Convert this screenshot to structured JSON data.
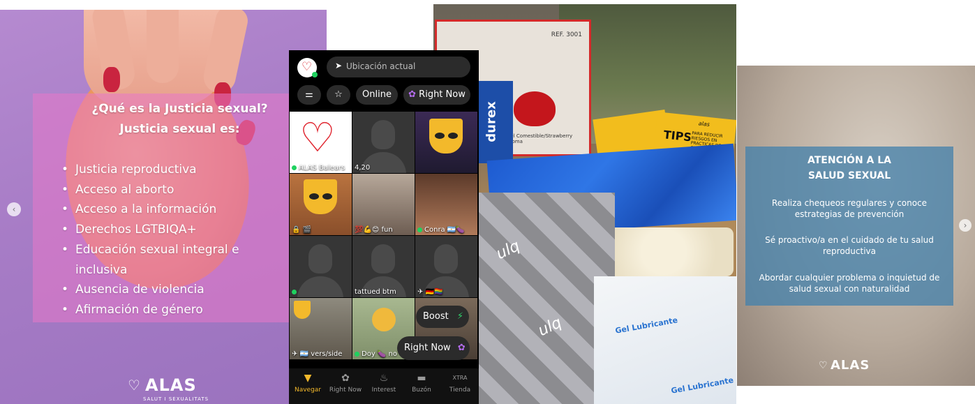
{
  "slide1": {
    "title_line1": "¿Qué es la Justicia sexual?",
    "title_line2": "Justicia sexual es:",
    "items": [
      "Justicia reproductiva",
      "Acceso al aborto",
      "Acceso a la información",
      "Derechos LGTBIQA+",
      "Educación sexual integral e inclusiva",
      "Ausencia de violencia",
      "Afirmación de género"
    ],
    "logo_text": "ALAS",
    "logo_sub": "SALUT I SEXUALITATS",
    "prev_arrow": "‹"
  },
  "slide2": {
    "location_placeholder": "Ubicación actual",
    "filters": {
      "online_label": "Online",
      "right_now_label": "Right Now"
    },
    "grid": [
      {
        "caption": "ALAS Balears",
        "online": true
      },
      {
        "caption": "4,20",
        "online": false
      },
      {
        "caption": "",
        "online": false
      },
      {
        "caption": "🔒 🎬",
        "online": false
      },
      {
        "caption": "💯💪😊 fun",
        "online": false
      },
      {
        "caption": "Conra 🇦🇷🍆",
        "online": true
      },
      {
        "caption": "",
        "online": true
      },
      {
        "caption": "tattued btm",
        "online": false
      },
      {
        "caption": "✈ 🇩🇪🏳️‍🌈",
        "online": false
      },
      {
        "caption": "✈ 🇦🇷 vers/side",
        "online": false
      },
      {
        "caption": "Doy 🍆 no",
        "online": true
      },
      {
        "caption": "",
        "online": false
      }
    ],
    "boost_label": "Boost",
    "right_now_button": "Right Now",
    "tabs": [
      "Navegar",
      "Right Now",
      "Interest",
      "Buzón",
      "Tienda"
    ],
    "tienda_badge": "XTRA",
    "colors": {
      "accent": "#f3b92b",
      "online": "#1fd15f"
    }
  },
  "slide3": {
    "box_brand": "durex",
    "box_ref": "REF. 3001",
    "box_tagline": "Gel Comestible/Strawberry Aroma",
    "tips_label": "TIPS",
    "tips_sub": "PARA REDUCIR RIESGOS EN PRACTICAS DE CHEMSEX",
    "alas_label": "alas",
    "lube_label": "Gel Lubricante",
    "packet_brand": "ulq"
  },
  "slide4": {
    "title_line1": "ATENCIÓN A LA",
    "title_line2": "SALUD SEXUAL",
    "paragraphs": [
      "Realiza chequeos regulares y conoce estrategias de prevención",
      "Sé proactivo/a en el cuidado de tu salud reproductiva",
      "Abordar cualquier problema o inquietud de salud sexual con naturalidad"
    ],
    "logo_text": "ALAS",
    "next_arrow": "›"
  }
}
